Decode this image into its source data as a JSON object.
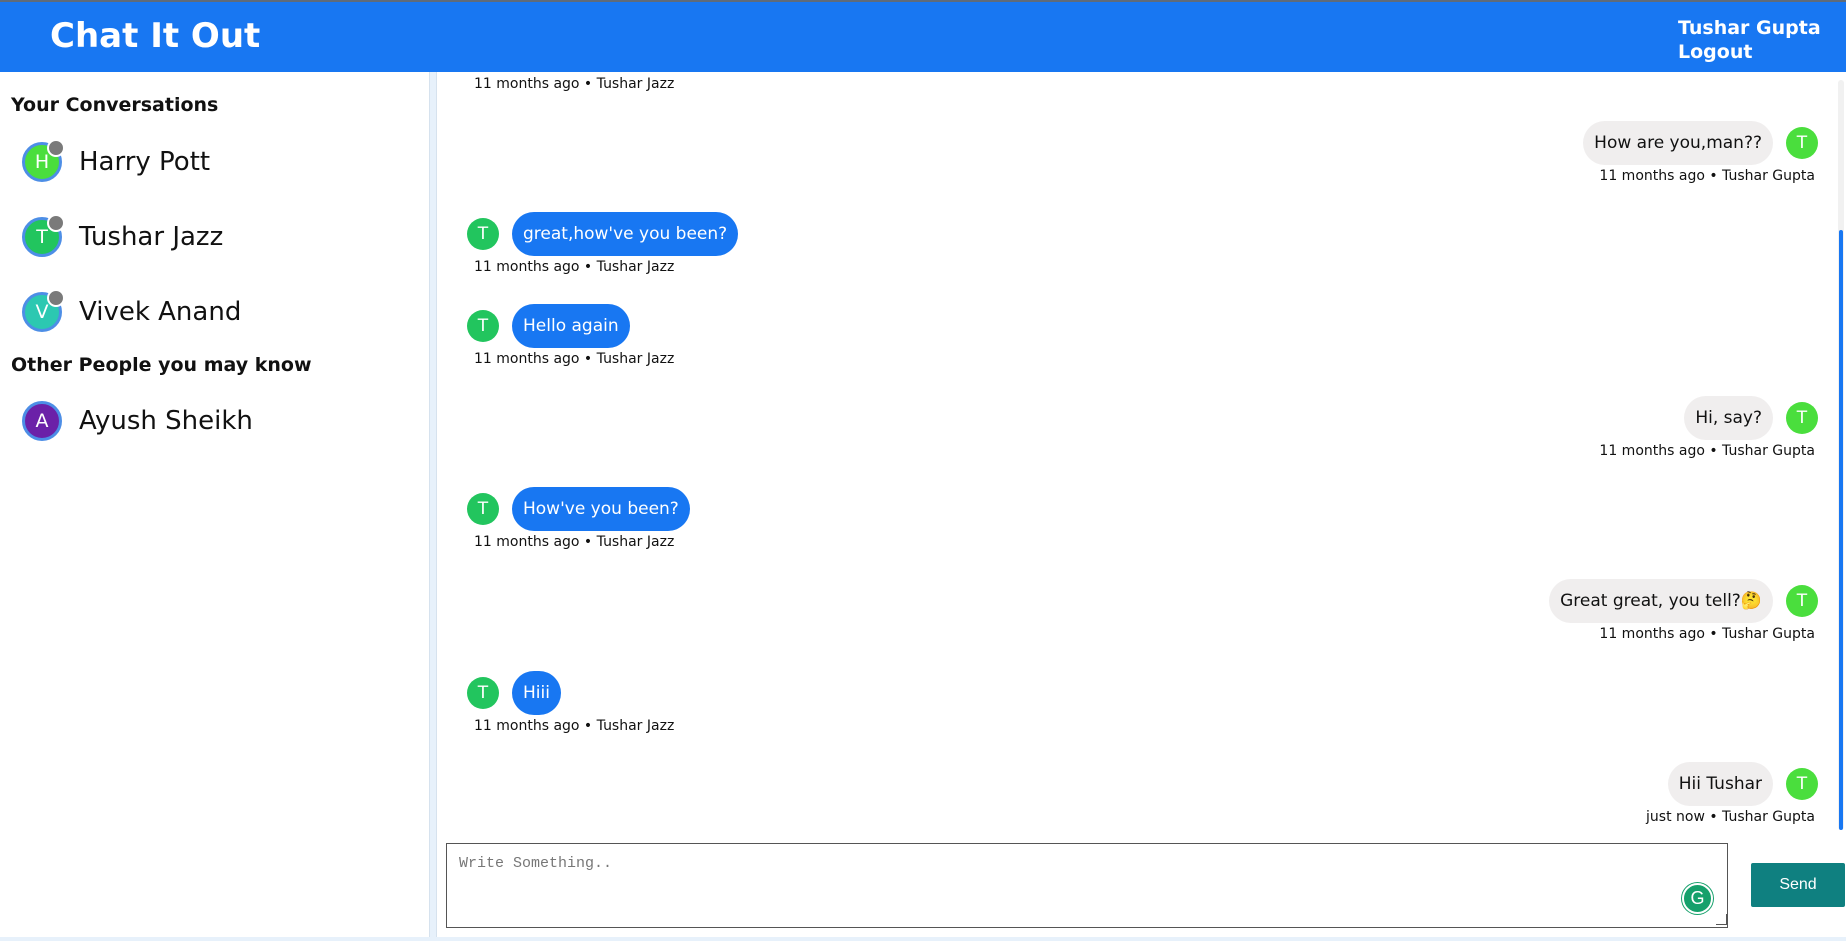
{
  "header": {
    "brand": "Chat It Out",
    "user_name": "Tushar Gupta",
    "logout_label": "Logout",
    "bg_color": "#1877f2"
  },
  "sidebar": {
    "conversations_title": "Your Conversations",
    "conversations": [
      {
        "initial": "H",
        "name": "Harry Pott",
        "avatar_color": "#4ade3d",
        "status": "offline"
      },
      {
        "initial": "T",
        "name": "Tushar Jazz",
        "avatar_color": "#22c55e",
        "status": "offline"
      },
      {
        "initial": "V",
        "name": "Vivek Anand",
        "avatar_color": "#2cc8b1",
        "status": "offline"
      }
    ],
    "others_title": "Other People you may know",
    "others": [
      {
        "initial": "A",
        "name": "Ayush Sheikh",
        "avatar_color": "#6b21a8"
      }
    ]
  },
  "chat": {
    "partial_top_meta": "11 months ago • Tushar Jazz",
    "messages": [
      {
        "direction": "out",
        "initial": "T",
        "text": "How are you,man??",
        "meta": "11 months ago • Tushar Gupta"
      },
      {
        "direction": "in",
        "initial": "T",
        "text": "great,how've you been?",
        "meta": "11 months ago • Tushar Jazz"
      },
      {
        "direction": "in",
        "initial": "T",
        "text": "Hello again",
        "meta": "11 months ago • Tushar Jazz"
      },
      {
        "direction": "out",
        "initial": "T",
        "text": "Hi, say?",
        "meta": "11 months ago • Tushar Gupta"
      },
      {
        "direction": "in",
        "initial": "T",
        "text": "How've you been?",
        "meta": "11 months ago • Tushar Jazz"
      },
      {
        "direction": "out",
        "initial": "T",
        "text": "Great great, you tell?🤔",
        "meta": "11 months ago • Tushar Gupta"
      },
      {
        "direction": "in",
        "initial": "T",
        "text": "Hiii",
        "meta": "11 months ago • Tushar Jazz"
      },
      {
        "direction": "out",
        "initial": "T",
        "text": "Hii Tushar",
        "meta": "just now • Tushar Gupta"
      }
    ]
  },
  "composer": {
    "placeholder": "Write Something..",
    "value": "",
    "send_label": "Send",
    "send_color": "#0f8080"
  }
}
